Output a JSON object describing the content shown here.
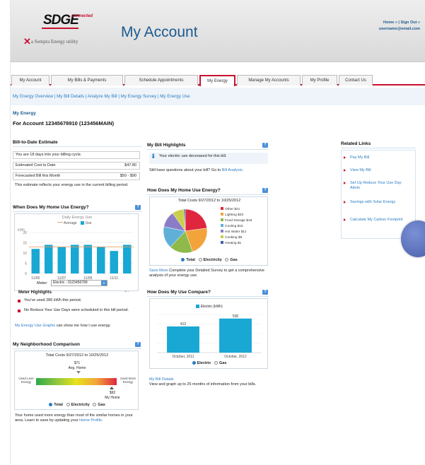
{
  "brand": {
    "logo_text": "SDGE",
    "logo_connected": "connected",
    "sempra_text": "a  Sempra Energy utility"
  },
  "header": {
    "title": "My Account",
    "top_links": "Home » | Sign Out »",
    "user_email": "username@email.com"
  },
  "tabs": [
    "My Account",
    "My Bills & Payments",
    "Schedule Appointments",
    "My Energy",
    "Manage My Accounts",
    "My Profile",
    "Contact Us"
  ],
  "subnav": "My Energy Overview | My Bill Details | Analyze My Bill | My Energy Survey | My Energy Use",
  "section": "My Energy",
  "account_line": "For Account 12345678910 (123456MAIN)",
  "bill_to_date": {
    "title": "Bill-to-Date Estimate",
    "rows": [
      {
        "label": "You are 18 days into your billing cycle.",
        "value": ""
      },
      {
        "label": "Estimated Cost to Date",
        "value": "$47.80"
      },
      {
        "label": "Forecasted Bill this Month",
        "value": "$50 - $90"
      }
    ],
    "note": "This estimate reflects your energy use in the current billing period."
  },
  "home_use": {
    "title": "When Does My Home Use Energy?",
    "chart_title": "Daily Energy Use",
    "legend_average": "Average",
    "legend_use": "Use",
    "y_unit": "kWh",
    "meter_label": "Meter:",
    "meter_value": "Electric - 0123456789",
    "highlights_title": "Meter Highlights",
    "highlights_controls": "+  −",
    "highlights": [
      "You've used 286 kWh this period.",
      "No Reduce Your Use Days were scheduled in this bill period."
    ],
    "graphs_link": "My Energy Use Graphs",
    "graphs_text": " can show me how I use energy."
  },
  "neighborhood": {
    "title": "My Neighborhood Comparison",
    "subtitle": "Total Costs 9/27/2012 to 10/25/2012",
    "avg_value": "$71",
    "avg_label": "Avg. Home",
    "left_label": "Used Less Energy",
    "right_label": "Used More Energy",
    "my_value": "$92",
    "my_label": "My Home",
    "radios": [
      "Total",
      "Electricity",
      "Gas"
    ],
    "note_prefix": "Your home used more energy than most of the similar homes in your area. Learn to save by updating your ",
    "note_link": "Home Profile."
  },
  "bill_highlights": {
    "title": "My Bill Highlights",
    "item": "Your electric use decreased for this bill.",
    "question_prefix": "Still have questions about your bill? Go to ",
    "question_link": "Bill Analysis."
  },
  "home_breakdown": {
    "title": "How Does My Home Use Energy?",
    "subtitle": "Total Costs 9/27/2012 to 10/25/2012",
    "radios": [
      "Total",
      "Electricity",
      "Gas"
    ],
    "save_link": "Save More",
    "save_text": "  Complete your Detailed Survey to get a comprehensive analysis of your energy use."
  },
  "compare": {
    "title": "How Does My Use Compare?",
    "legend": "Electric (kWh)",
    "radios": [
      "Electric",
      "Gas"
    ],
    "details_link": "My Bill Details",
    "details_text": "View and graph up to 25 months of information from your bills."
  },
  "related": {
    "title": "Related Links",
    "items": [
      "Pay My Bill",
      "View My Bill",
      "Set Up Reduce Your Use Day Alerts",
      "Savings with Solar Energy",
      "Calculate My Carbon Footprint"
    ]
  },
  "colors": {
    "accent": "#c8102e",
    "link": "#2b7cc4",
    "bar": "#19a7d4"
  },
  "chart_data": [
    {
      "type": "bar",
      "title": "Daily Energy Use",
      "ylabel": "kWh",
      "categories": [
        "11/05",
        "",
        "11/07",
        "",
        "11/09",
        "",
        "11/11",
        ""
      ],
      "series": [
        {
          "name": "Use",
          "values": [
            12,
            14,
            13,
            14,
            14,
            13,
            11,
            14
          ]
        }
      ],
      "average": 13,
      "ylim": [
        0,
        20
      ],
      "yticks": [
        0,
        5,
        10,
        15,
        20
      ]
    },
    {
      "type": "pie",
      "title": "Total Costs 9/27/2012 to 10/25/2012",
      "categories": [
        "Other",
        "Lighting",
        "Food Storage",
        "Cooling",
        "Hot Water",
        "Cooking",
        "Heating"
      ],
      "values": [
        21,
        20,
        16,
        15,
        11,
        8,
        1
      ],
      "labels": [
        "Other $21",
        "Lighting $20",
        "Food Storage $16",
        "Cooling $15",
        "Hot Water $11",
        "Cooking $8",
        "Heating $1"
      ],
      "colors": [
        "#e0263e",
        "#f2a33a",
        "#8fb94b",
        "#5fb0d8",
        "#8a7cc7",
        "#c9cf4a",
        "#3d5fa8"
      ]
    },
    {
      "type": "bar",
      "categories": [
        "October, 2011",
        "October, 2012"
      ],
      "series": [
        {
          "name": "Electric (kWh)",
          "values": [
            412,
            536
          ]
        }
      ],
      "ylim": [
        0,
        600
      ]
    }
  ]
}
